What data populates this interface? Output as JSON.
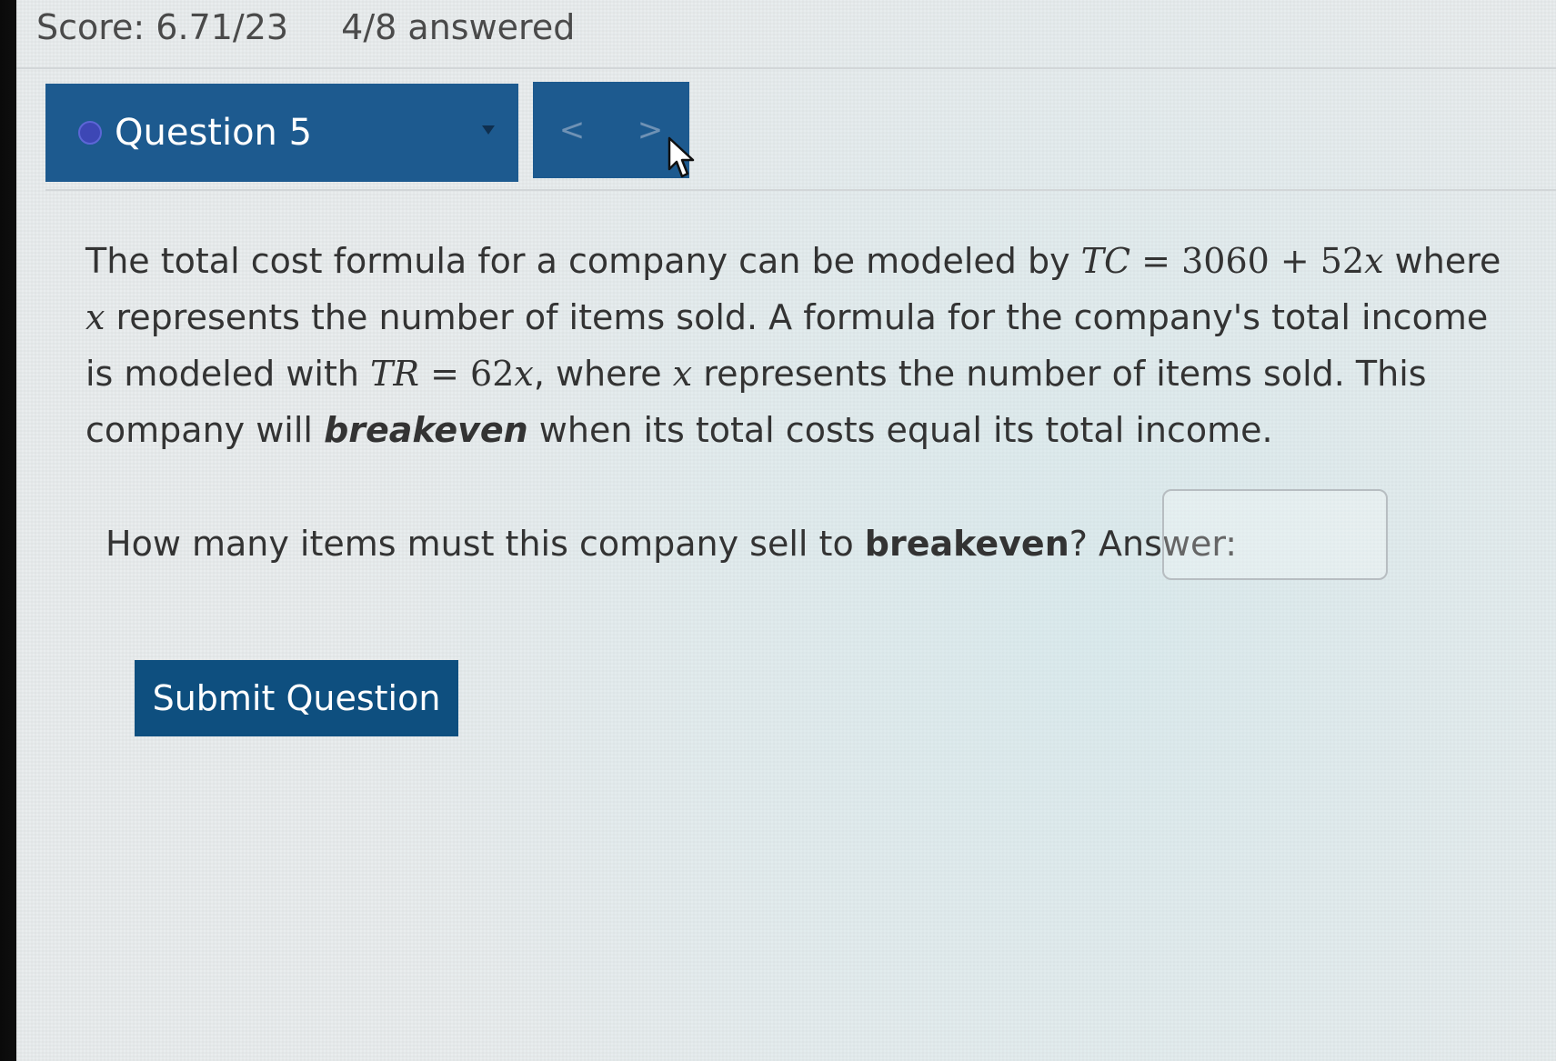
{
  "header": {
    "score": "Score: 6.71/23",
    "answered": "4/8 answered"
  },
  "question_nav": {
    "current_label": "Question 5",
    "prev_label": "<",
    "next_label": ">"
  },
  "question": {
    "p1": "The total cost formula for a company can be modeled by ",
    "tc_var": "TC",
    "tc_rhs": "3060 + 52",
    "x": "x",
    "p2": " where ",
    "p3": " represents the number of items sold. A formula for the company's total income is modeled with ",
    "tr_var": "TR",
    "tr_rhs": "62",
    "p4": ", where ",
    "p5": " represents the number of items sold. This company will ",
    "bold_word": "breakeven",
    "p6": " when its total costs equal its total income.",
    "prompt_start": "How many items must this company sell to ",
    "prompt_end": "? Answer:"
  },
  "answer": {
    "value": "",
    "placeholder": ""
  },
  "actions": {
    "submit_label": "Submit Question"
  },
  "colors": {
    "primary_blue": "#1d5a8f",
    "submit_blue": "#0e4f7f",
    "status_dot": "#3d47b5"
  }
}
